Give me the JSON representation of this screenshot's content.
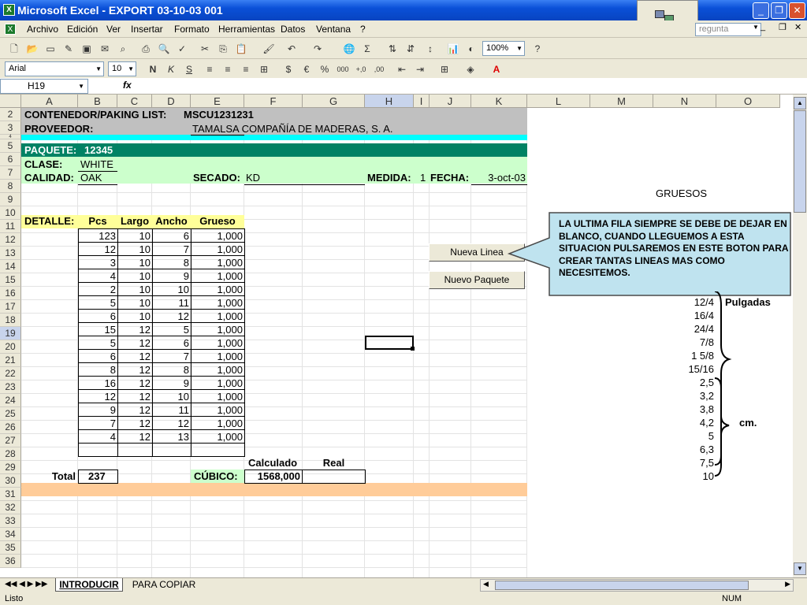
{
  "window": {
    "title": "Microsoft Excel - EXPORT 03-10-03 001"
  },
  "menu": {
    "items": [
      "Archivo",
      "Edición",
      "Ver",
      "Insertar",
      "Formato",
      "Herramientas",
      "Datos",
      "Ventana",
      "?"
    ],
    "help_placeholder": "regunta"
  },
  "toolbar": {
    "zoom": "100%",
    "font": "Arial",
    "size": "10"
  },
  "formula": {
    "cell_ref": "H19",
    "fx": "fx"
  },
  "columns": [
    "A",
    "B",
    "C",
    "D",
    "E",
    "F",
    "G",
    "H",
    "I",
    "J",
    "K",
    "L",
    "M",
    "N",
    "O"
  ],
  "rows": [
    "2",
    "3",
    "4",
    "5",
    "6",
    "7",
    "8",
    "9",
    "10",
    "11",
    "12",
    "13",
    "14",
    "15",
    "16",
    "17",
    "18",
    "19",
    "20",
    "21",
    "22",
    "23",
    "24",
    "25",
    "26",
    "27",
    "28",
    "29",
    "30",
    "31",
    "32",
    "33",
    "34",
    "35",
    "36"
  ],
  "header": {
    "container_label": "CONTENEDOR/PAKING LIST:",
    "container_value": "MSCU1231231",
    "supplier_label": "PROVEEDOR:",
    "supplier_value": "TAMALSA COMPAÑÍA DE MADERAS, S. A.",
    "package_label": "PAQUETE:",
    "package_value": "12345",
    "class_label": "CLASE:",
    "class_value": "WHITE",
    "quality_label": "CALIDAD:",
    "quality_value": "OAK",
    "drying_label": "SECADO:",
    "drying_value": "KD",
    "measure_label": "MEDIDA:",
    "measure_value": "1",
    "date_label": "FECHA:",
    "date_value": "3-oct-03"
  },
  "detail": {
    "label": "DETALLE:",
    "headers": [
      "Pcs",
      "Largo",
      "Ancho",
      "Grueso"
    ],
    "rows": [
      [
        "123",
        "10",
        "6",
        "1,000"
      ],
      [
        "12",
        "10",
        "7",
        "1,000"
      ],
      [
        "3",
        "10",
        "8",
        "1,000"
      ],
      [
        "4",
        "10",
        "9",
        "1,000"
      ],
      [
        "2",
        "10",
        "10",
        "1,000"
      ],
      [
        "5",
        "10",
        "11",
        "1,000"
      ],
      [
        "6",
        "10",
        "12",
        "1,000"
      ],
      [
        "15",
        "12",
        "5",
        "1,000"
      ],
      [
        "5",
        "12",
        "6",
        "1,000"
      ],
      [
        "6",
        "12",
        "7",
        "1,000"
      ],
      [
        "8",
        "12",
        "8",
        "1,000"
      ],
      [
        "16",
        "12",
        "9",
        "1,000"
      ],
      [
        "12",
        "12",
        "10",
        "1,000"
      ],
      [
        "9",
        "12",
        "11",
        "1,000"
      ],
      [
        "7",
        "12",
        "12",
        "1,000"
      ],
      [
        "4",
        "12",
        "13",
        "1,000"
      ],
      [
        "",
        "",
        "",
        ""
      ]
    ]
  },
  "totals": {
    "total_label": "Total",
    "total_value": "237",
    "calc_label": "Calculado",
    "real_label": "Real",
    "cubic_label": "CÚBICO:",
    "cubic_calc": "1568,000",
    "cubic_real": ""
  },
  "buttons": {
    "new_line": "Nueva Linea",
    "new_package": "Nuevo Paquete"
  },
  "callout": {
    "text": "LA ULTIMA FILA SIEMPRE SE DEBE DE DEJAR EN BLANCO, CUANDO LLEGUEMOS A ESTA SITUACION PULSAREMOS EN ESTE BOTON PARA CREAR TANTAS LINEAS MAS COMO  NECESITEMOS."
  },
  "gruesos": {
    "title": "GRUESOS",
    "inch_label": "Pulgadas",
    "inch_values": [
      "12/4",
      "16/4",
      "24/4",
      "7/8",
      "1 5/8",
      "15/16"
    ],
    "cm_label": "cm.",
    "cm_values": [
      "2,5",
      "3,2",
      "3,8",
      "4,2",
      "5",
      "6,3",
      "7,5",
      "10"
    ]
  },
  "sheets": {
    "active": "INTRODUCIR",
    "other": "PARA COPIAR"
  },
  "status": {
    "left": "Listo",
    "right": "NUM"
  },
  "colors": {
    "gray": "#c0c0c0",
    "teal": "#008264",
    "cyan": "#00ffff",
    "mint": "#ccffcc",
    "yellow": "#ffff99",
    "peach": "#ffcc99",
    "callout": "#bfe3ef",
    "titlebar": "#0a50d8"
  }
}
